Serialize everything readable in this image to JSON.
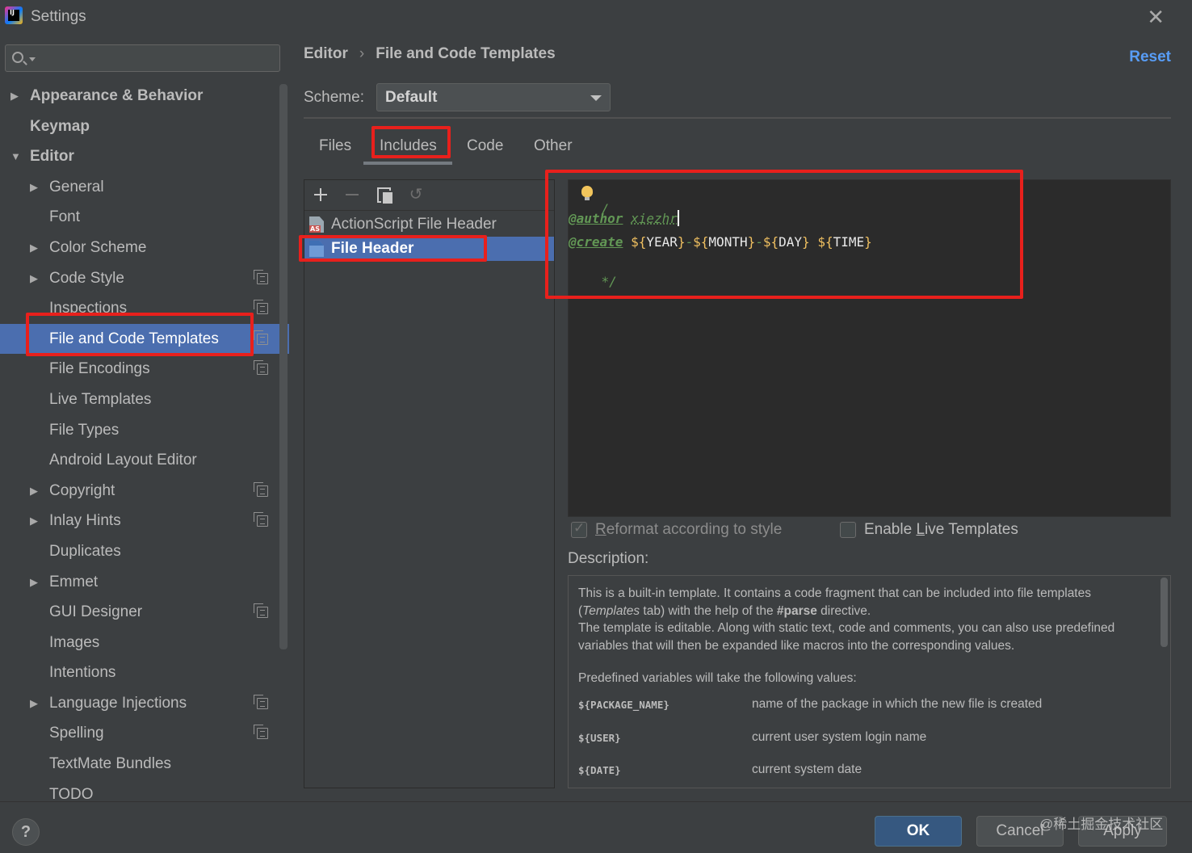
{
  "window": {
    "title": "Settings"
  },
  "search": {
    "placeholder": ""
  },
  "tree": [
    {
      "label": "Appearance & Behavior",
      "level": 0,
      "arrow": "▶",
      "copy": false
    },
    {
      "label": "Keymap",
      "level": 0,
      "arrow": "",
      "copy": false
    },
    {
      "label": "Editor",
      "level": 0,
      "arrow": "▼",
      "copy": false
    },
    {
      "label": "General",
      "level": 1,
      "arrow": "▶",
      "copy": false
    },
    {
      "label": "Font",
      "level": 1,
      "arrow": "",
      "copy": false
    },
    {
      "label": "Color Scheme",
      "level": 1,
      "arrow": "▶",
      "copy": false
    },
    {
      "label": "Code Style",
      "level": 1,
      "arrow": "▶",
      "copy": true
    },
    {
      "label": "Inspections",
      "level": 1,
      "arrow": "",
      "copy": true
    },
    {
      "label": "File and Code Templates",
      "level": 1,
      "arrow": "",
      "copy": true,
      "selected": true
    },
    {
      "label": "File Encodings",
      "level": 1,
      "arrow": "",
      "copy": true
    },
    {
      "label": "Live Templates",
      "level": 1,
      "arrow": "",
      "copy": false
    },
    {
      "label": "File Types",
      "level": 1,
      "arrow": "",
      "copy": false
    },
    {
      "label": "Android Layout Editor",
      "level": 1,
      "arrow": "",
      "copy": false
    },
    {
      "label": "Copyright",
      "level": 1,
      "arrow": "▶",
      "copy": true
    },
    {
      "label": "Inlay Hints",
      "level": 1,
      "arrow": "▶",
      "copy": true
    },
    {
      "label": "Duplicates",
      "level": 1,
      "arrow": "",
      "copy": false
    },
    {
      "label": "Emmet",
      "level": 1,
      "arrow": "▶",
      "copy": false
    },
    {
      "label": "GUI Designer",
      "level": 1,
      "arrow": "",
      "copy": true
    },
    {
      "label": "Images",
      "level": 1,
      "arrow": "",
      "copy": false
    },
    {
      "label": "Intentions",
      "level": 1,
      "arrow": "",
      "copy": false
    },
    {
      "label": "Language Injections",
      "level": 1,
      "arrow": "▶",
      "copy": true
    },
    {
      "label": "Spelling",
      "level": 1,
      "arrow": "",
      "copy": true
    },
    {
      "label": "TextMate Bundles",
      "level": 1,
      "arrow": "",
      "copy": false
    },
    {
      "label": "TODO",
      "level": 1,
      "arrow": "",
      "copy": false
    }
  ],
  "breadcrumb": {
    "parent": "Editor",
    "separator": "›",
    "current": "File and Code Templates"
  },
  "reset_label": "Reset",
  "scheme": {
    "label": "Scheme:",
    "value": "Default"
  },
  "tabs": [
    "Files",
    "Includes",
    "Code",
    "Other"
  ],
  "active_tab": "Includes",
  "template_list": {
    "items": [
      {
        "label": "ActionScript File Header",
        "icon": "actionscript-file-icon"
      },
      {
        "label": "File Header",
        "icon": "file-header-icon",
        "selected": true
      }
    ]
  },
  "editor": {
    "line1": "/",
    "line2_tag": "@author",
    "line2_value": "xiezhr",
    "line3_tag": "@create",
    "line3_year_open": "${",
    "line3_year": "YEAR",
    "line3_close": "}",
    "line3_month": "MONTH",
    "line3_day": "DAY",
    "line3_time": "TIME",
    "line3_dash": "-",
    "line4": "*/"
  },
  "options": {
    "reformat_label_prefix": "",
    "reformat_mnemonic": "R",
    "reformat_label_rest": "eformat according to style",
    "reformat_checked": true,
    "live_label_prefix": "Enable ",
    "live_mnemonic": "L",
    "live_label_rest": "ive Templates",
    "live_checked": false
  },
  "description": {
    "label": "Description:",
    "p1_a": "This is a built-in template. It contains a code fragment that can be included into file templates (",
    "p1_templates": "Templates",
    "p1_b": " tab) with the help of the ",
    "p1_parse": "#parse",
    "p1_c": " directive.",
    "p1_d": "The template is editable. Along with static text, code and comments, you can also use predefined variables that will then be expanded like macros into the corresponding values.",
    "p2": "Predefined variables will take the following values:",
    "variables": [
      {
        "name": "${PACKAGE_NAME}",
        "desc": "name of the package in which the new file is created"
      },
      {
        "name": "${USER}",
        "desc": "current user system login name"
      },
      {
        "name": "${DATE}",
        "desc": "current system date"
      }
    ]
  },
  "buttons": {
    "help": "?",
    "ok": "OK",
    "cancel": "Cancel",
    "apply": "Apply"
  },
  "watermark": "@稀土掘金技术社区",
  "colors": {
    "selection": "#4b6eaf",
    "highlight_box": "#e8201c",
    "link": "#589df6",
    "comment": "#629755"
  }
}
